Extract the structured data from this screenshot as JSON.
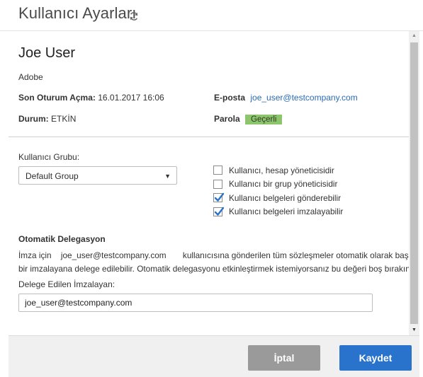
{
  "header": {
    "title": "Kullanıcı Ayarları",
    "refresh_icon": "refresh-icon"
  },
  "user": {
    "name": "Joe User",
    "company": "Adobe",
    "last_login_label": "Son Oturum Açma:",
    "last_login_value": "16.01.2017 16:06",
    "status_label": "Durum:",
    "status_value": "ETKİN",
    "email_label": "E-posta",
    "email_value": "joe_user@testcompany.com",
    "password_label": "Parola",
    "password_status": "Geçerli",
    "password_badge_color": "#8cc56b"
  },
  "group": {
    "label": "Kullanıcı Grubu:",
    "selected": "Default Group"
  },
  "permissions": [
    {
      "label": "Kullanıcı, hesap yöneticisidir",
      "checked": false
    },
    {
      "label": "Kullanıcı bir grup yöneticisidir",
      "checked": false
    },
    {
      "label": "Kullanıcı belgeleri gönderebilir",
      "checked": true
    },
    {
      "label": "Kullanıcı belgeleri imzalayabilir",
      "checked": true
    }
  ],
  "delegation": {
    "title": "Otomatik Delegasyon",
    "text_prefix": "İmza için",
    "text_email": "joe_user@testcompany.com",
    "text_suffix": "kullanıcısına gönderilen tüm sözleşmeler otomatik olarak başka",
    "text_line2": "bir imzalayana delege edilebilir. Otomatik delegasyonu etkinleştirmek istemiyorsanız bu değeri boş bırakın.",
    "input_label": "Delege Edilen İmzalayan:",
    "input_value": "joe_user@testcompany.com"
  },
  "footer": {
    "cancel_label": "İptal",
    "save_label": "Kaydet"
  },
  "colors": {
    "accent": "#2a73cc",
    "check": "#2a73cc",
    "link": "#2b6bb5"
  }
}
